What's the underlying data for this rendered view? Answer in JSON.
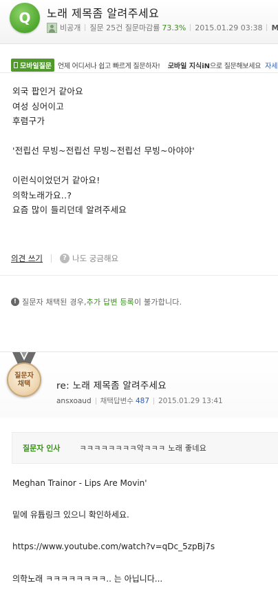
{
  "question": {
    "badge": "Q",
    "title": "노래 제목좀 알려주세요",
    "author": "비공개",
    "stats": "질문 25건 질문마감률",
    "rate": "73.3%",
    "date": "2015.01.29 03:38",
    "meta_more": "M",
    "body": "외국 팝인거 같아요\n여성 싱어이고\n후렴구가\n\n'전립선 무빙~전립선 무빙~전립선 무빙~아야야'\n\n이런식이었던거 같아요!\n의학노래가요..?\n요즘 많이 들리던데 알려주세요"
  },
  "mobile_banner": {
    "badge": "모바일질문",
    "text": "언제 어디서나 쉽고 빠르게 질문하자!",
    "link_bold": "모바일 지식iN",
    "link_rest": "으로 질문해보세요",
    "more": "자세히"
  },
  "actions": {
    "opinion": "의견 쓰기",
    "curious": "나도 궁금해요"
  },
  "notice": {
    "pre": "질문자 채택된 경우, ",
    "highlight": "추가 답변 등록",
    "post": "이 불가합니다."
  },
  "answer": {
    "medal_line1": "질문자",
    "medal_line2": "채택",
    "title": "re: 노래 제목좀 알려주세요",
    "author": "ansxoaud",
    "count_label": "채택답변수",
    "count": "487",
    "date": "2015.01.29 13:41",
    "greeting_label": "질문자 인사",
    "greeting_text": "ㅋㅋㅋㅋㅋㅋㅋㅋ악ㅋㅋㅋ 노래 좋네요",
    "body_lines": [
      "Meghan Trainor - Lips Are Movin'",
      "밑에 유튭링크 있으니 확인하세요.",
      "https://www.youtube.com/watch?v=qDc_5zpBj7s",
      "의학노래 ㅋㅋㅋㅋㅋㅋㅋㅋ.. 는 아닙니다..."
    ]
  },
  "colors": {
    "accent_green": "#3a8f1c",
    "link_blue": "#2a5db0",
    "medal_gold": "#efd8b4"
  }
}
